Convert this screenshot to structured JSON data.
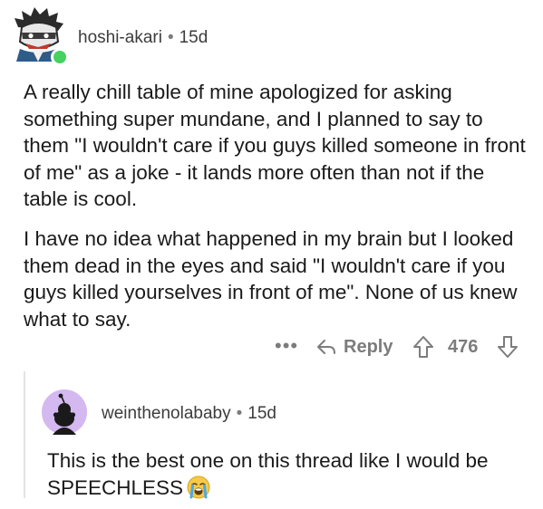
{
  "comment": {
    "username": "hoshi-akari",
    "separator": "•",
    "age": "15d",
    "paragraphs": [
      "A really chill table of mine apologized for asking something super mundane, and I planned to say to them \"I wouldn't care if you guys killed someone in front of me\" as a joke - it lands more often than not if the table is cool.",
      "I have no idea what happened in my brain but I looked them dead in the eyes and said \"I wouldn't care if you guys killed yourselves in front of me\". None of us knew what to say."
    ],
    "actions": {
      "more": "•••",
      "reply_label": "Reply",
      "vote_count": "476"
    }
  },
  "reply": {
    "username": "weinthenolababy",
    "separator": "•",
    "age": "15d",
    "text": "This is the best one on this thread like I would be SPEECHLESS"
  },
  "icons": {
    "online_indicator": "online-dot",
    "reply": "reply-arrow-icon",
    "upvote": "upvote-arrow-icon",
    "downvote": "downvote-arrow-icon",
    "emoji": "loudly-crying-face-emoji"
  },
  "colors": {
    "online": "#46d160",
    "meta_text": "#7c7c7c",
    "reply_avatar_bg": "#d4b8f0"
  }
}
